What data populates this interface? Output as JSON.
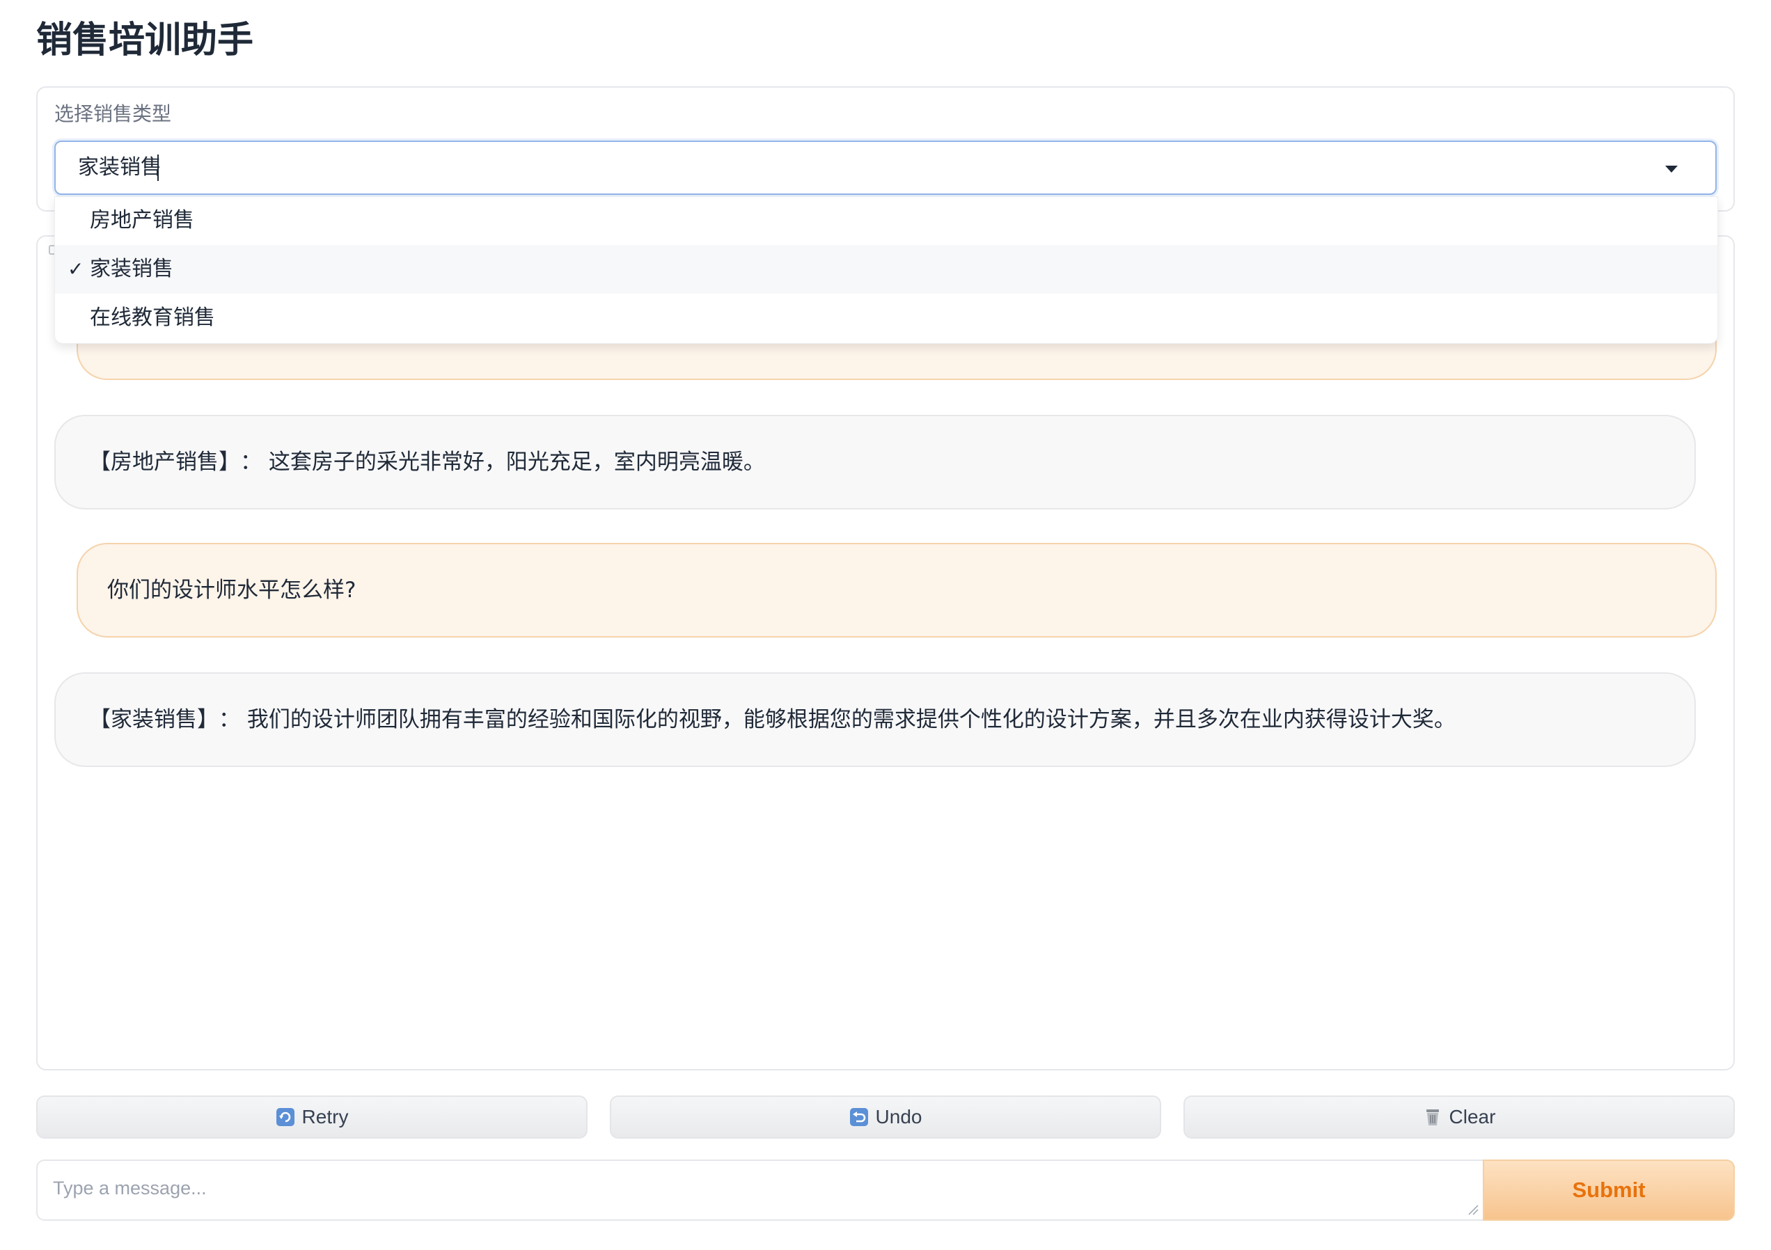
{
  "app": {
    "title": "销售培训助手"
  },
  "selector": {
    "label": "选择销售类型",
    "value": "家装销售",
    "options": [
      {
        "label": "房地产销售",
        "selected": false
      },
      {
        "label": "家装销售",
        "selected": true
      },
      {
        "label": "在线教育销售",
        "selected": false
      }
    ],
    "check_glyph": "✓"
  },
  "chat": {
    "messages": [
      {
        "role": "bot",
        "speaker": "【房地产销售】",
        "text": "：  这套房子的采光非常好，阳光充足，室内明亮温暖。"
      },
      {
        "role": "user",
        "text": "你们的设计师水平怎么样?"
      },
      {
        "role": "bot",
        "speaker": "【家装销售】",
        "text": "：  我们的设计师团队拥有丰富的经验和国际化的视野，能够根据您的需求提供个性化的设计方案，并且多次在业内获得设计大奖。"
      }
    ]
  },
  "actions": {
    "retry_label": "Retry",
    "undo_label": "Undo",
    "clear_label": "Clear"
  },
  "input": {
    "placeholder": "Type a message...",
    "value": "",
    "submit_label": "Submit"
  },
  "colors": {
    "accent": "#e8720c",
    "user_bubble": "#fdf4ea",
    "bot_bubble": "#f8f8f9",
    "focus_border": "#93b4e8"
  },
  "icons": {
    "dropdown": "chevron-down-icon",
    "retry": "retry-icon",
    "undo": "undo-icon",
    "clear": "trash-icon",
    "resize": "resize-grip-icon"
  }
}
